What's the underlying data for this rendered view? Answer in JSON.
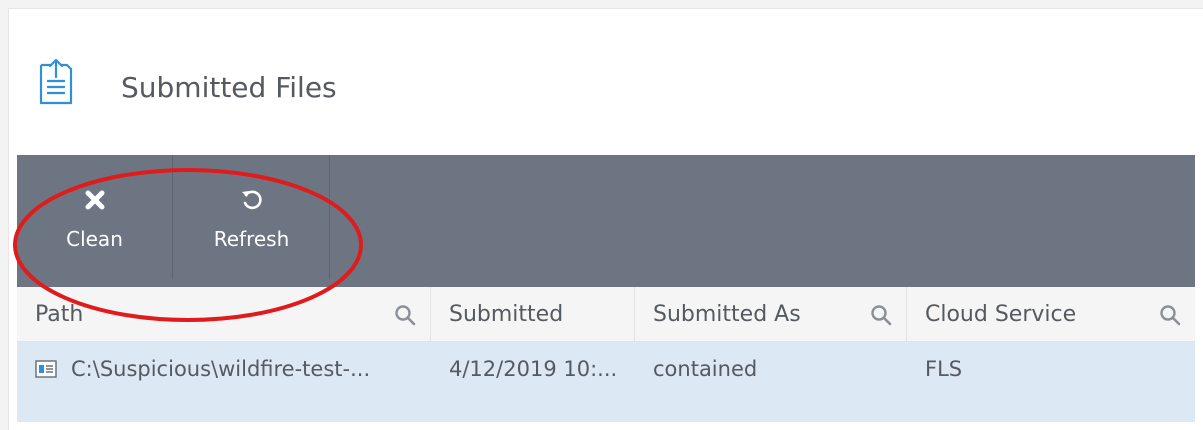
{
  "header": {
    "title": "Submitted Files",
    "icon": "upload-document-icon"
  },
  "toolbar": {
    "buttons": [
      {
        "label": "Clean",
        "icon": "close-icon"
      },
      {
        "label": "Refresh",
        "icon": "refresh-icon"
      }
    ]
  },
  "table": {
    "columns": [
      {
        "label": "Path",
        "searchable": true
      },
      {
        "label": "Submitted",
        "searchable": false
      },
      {
        "label": "Submitted As",
        "searchable": true
      },
      {
        "label": "Cloud Service",
        "searchable": true
      }
    ],
    "rows": [
      {
        "path": "C:\\Suspicious\\wildfire-test-...",
        "submitted": "4/12/2019 10:...",
        "submitted_as": "contained",
        "cloud_service": "FLS"
      }
    ]
  },
  "colors": {
    "toolbar": "#6d7583",
    "selected_row": "#dde8f5",
    "highlight_ellipse": "#e01b1b",
    "icon_blue": "#2f8fd8"
  }
}
